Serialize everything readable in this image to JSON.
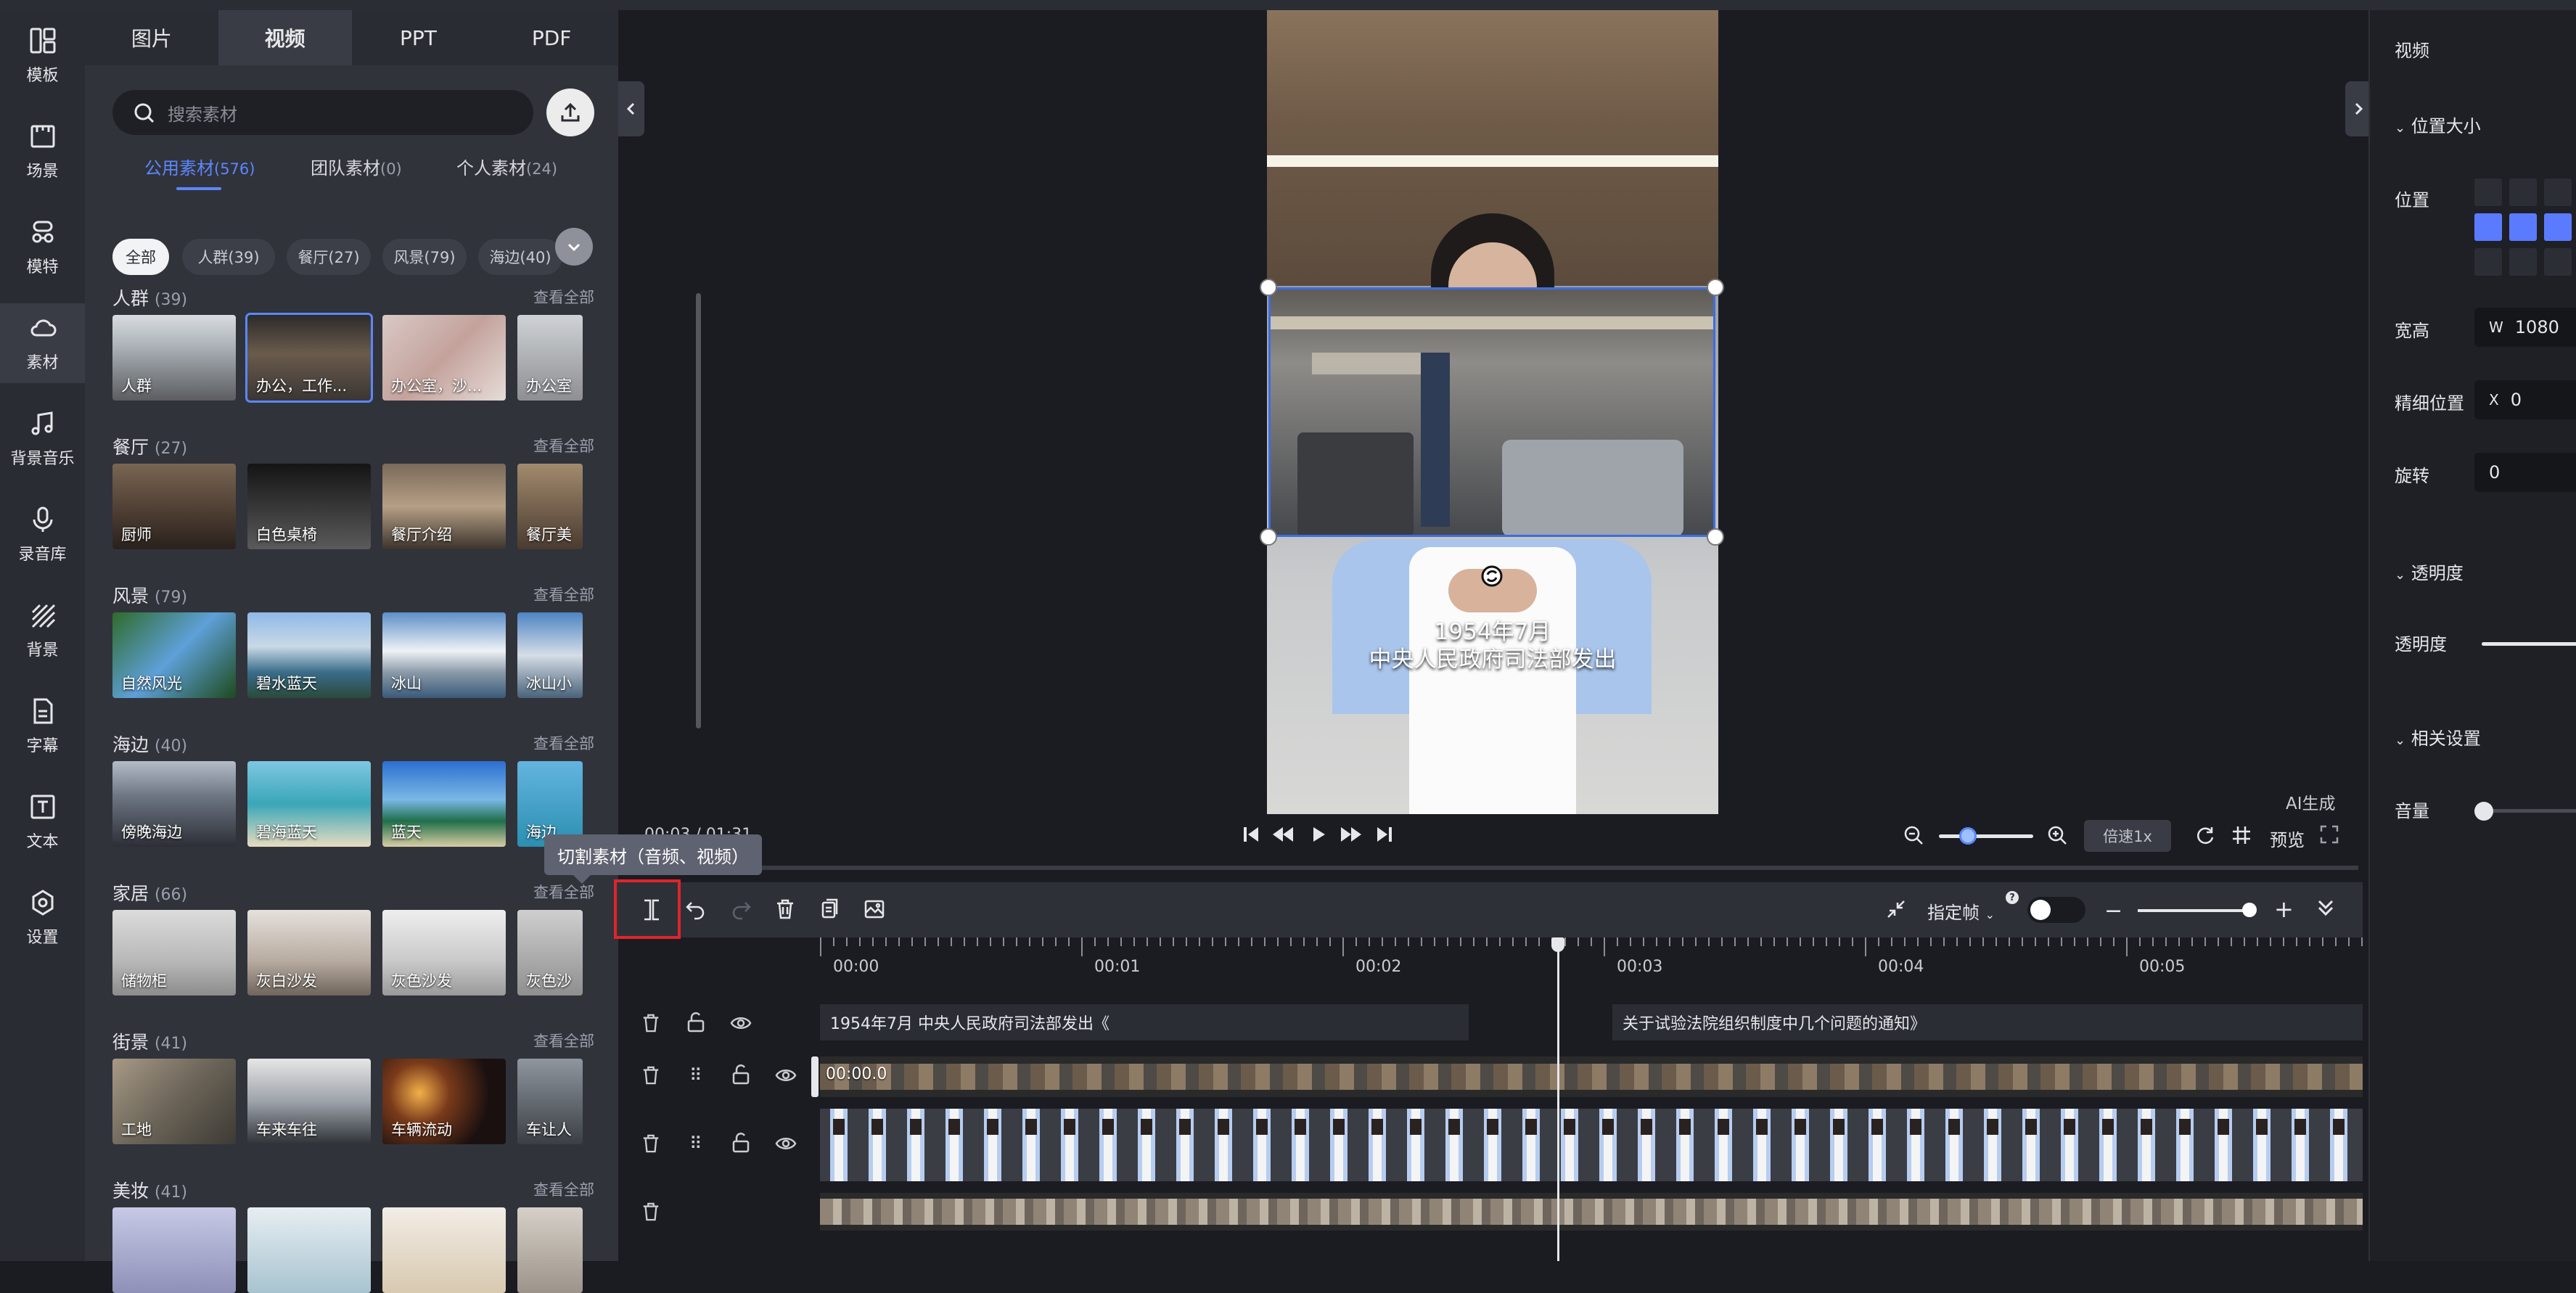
{
  "rail": [
    {
      "label": "模板",
      "icon": "template-icon"
    },
    {
      "label": "场景",
      "icon": "scene-icon"
    },
    {
      "label": "模特",
      "icon": "model-icon"
    },
    {
      "label": "素材",
      "icon": "cloud-icon"
    },
    {
      "label": "背景音乐",
      "icon": "music-icon"
    },
    {
      "label": "录音库",
      "icon": "microphone-icon"
    },
    {
      "label": "背景",
      "icon": "background-icon"
    },
    {
      "label": "字幕",
      "icon": "subtitle-icon"
    },
    {
      "label": "文本",
      "icon": "text-icon"
    },
    {
      "label": "设置",
      "icon": "gear-icon"
    }
  ],
  "asset_tabs": [
    "图片",
    "视频",
    "PPT",
    "PDF"
  ],
  "search": {
    "placeholder": "搜索素材"
  },
  "source_tabs": [
    {
      "label": "公用素材",
      "count": "(576)"
    },
    {
      "label": "团队素材",
      "count": "(0)"
    },
    {
      "label": "个人素材",
      "count": "(24)"
    }
  ],
  "chips": [
    "全部",
    "人群(39)",
    "餐厅(27)",
    "风景(79)",
    "海边(40)"
  ],
  "view_all": "查看全部",
  "categories": [
    {
      "title": "人群",
      "count": "(39)",
      "items": [
        "人群",
        "办公，工作...",
        "办公室，沙...",
        "办公室"
      ]
    },
    {
      "title": "餐厅",
      "count": "(27)",
      "items": [
        "厨师",
        "白色桌椅",
        "餐厅介绍",
        "餐厅美"
      ]
    },
    {
      "title": "风景",
      "count": "(79)",
      "items": [
        "自然风光",
        "碧水蓝天",
        "冰山",
        "冰山小"
      ]
    },
    {
      "title": "海边",
      "count": "(40)",
      "items": [
        "傍晚海边",
        "碧海蓝天",
        "蓝天",
        "海边"
      ]
    },
    {
      "title": "家居",
      "count": "(66)",
      "items": [
        "储物柜",
        "灰白沙发",
        "灰色沙发",
        "灰色沙"
      ]
    },
    {
      "title": "街景",
      "count": "(41)",
      "items": [
        "工地",
        "车来车往",
        "车辆流动",
        "车让人"
      ]
    },
    {
      "title": "美妆",
      "count": "(41)",
      "items": [
        "",
        "",
        "",
        ""
      ]
    }
  ],
  "preview": {
    "subtitle_line1": "1954年7月",
    "subtitle_line2": "中央人民政府司法部发出",
    "ai_label": "AI生成",
    "time": "00:03 / 01:31",
    "speed": "倍速1x",
    "preview_label": "预览"
  },
  "tooltip": "切割素材（音频、视频）",
  "timeline": {
    "frame_label": "指定帧",
    "ticks": [
      "00:00",
      "00:01",
      "00:02",
      "00:03",
      "00:04",
      "00:05"
    ],
    "caption_a": "1954年7月 中央人民政府司法部发出《",
    "caption_b": "关于试验法院组织制度中几个问题的通知》",
    "clip_time": "00:00.0"
  },
  "right_panel": {
    "title": "视频",
    "section_position": "位置大小",
    "position_label": "位置",
    "size_label": "宽高",
    "width_prefix": "W",
    "width_value": "1080",
    "fine_label": "精细位置",
    "x_prefix": "X",
    "x_value": "0",
    "rotate_label": "旋转",
    "rotate_value": "0",
    "section_opacity": "透明度",
    "opacity_label": "透明度",
    "section_related": "相关设置",
    "volume_label": "音量"
  },
  "colors": {
    "accent": "#5b87ff",
    "highlight": "#e0242a"
  }
}
